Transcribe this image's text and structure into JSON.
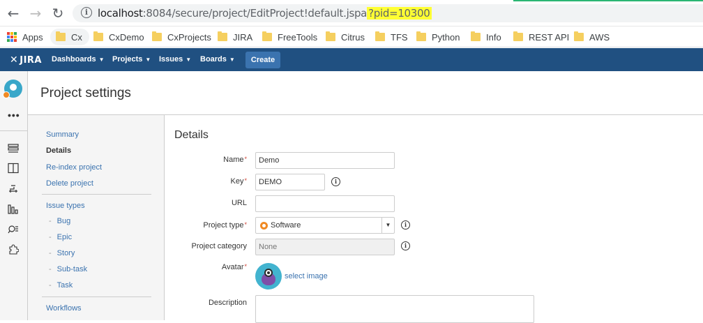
{
  "browser": {
    "url_host": "localhost",
    "url_path": ":8084/secure/project/EditProject!default.jspa",
    "url_query": "?pid=10300",
    "bookmarks": [
      "Apps",
      "Cx",
      "CxDemo",
      "CxProjects",
      "JIRA",
      "FreeTools",
      "Citrus",
      "TFS",
      "Python",
      "Info",
      "REST API",
      "AWS"
    ]
  },
  "header": {
    "logo": "JIRA",
    "nav": [
      "Dashboards",
      "Projects",
      "Issues",
      "Boards"
    ],
    "create_label": "Create"
  },
  "page": {
    "title": "Project settings"
  },
  "settings_nav": {
    "items": [
      "Summary",
      "Details",
      "Re-index project",
      "Delete project"
    ],
    "active": "Details",
    "issue_types_label": "Issue types",
    "issue_types": [
      "Bug",
      "Epic",
      "Story",
      "Sub-task",
      "Task"
    ],
    "workflows_label": "Workflows"
  },
  "details": {
    "section_title": "Details",
    "name_label": "Name",
    "name_value": "Demo",
    "key_label": "Key",
    "key_value": "DEMO",
    "url_label": "URL",
    "url_value": "",
    "project_type_label": "Project type",
    "project_type_value": "Software",
    "project_category_label": "Project category",
    "project_category_value": "None",
    "avatar_label": "Avatar",
    "select_image_label": "select image",
    "description_label": "Description"
  },
  "colors": {
    "header_bg": "#205081",
    "create_btn": "#3b73af",
    "link": "#3b73af",
    "required": "#d04437",
    "url_highlight": "#ffff33"
  }
}
